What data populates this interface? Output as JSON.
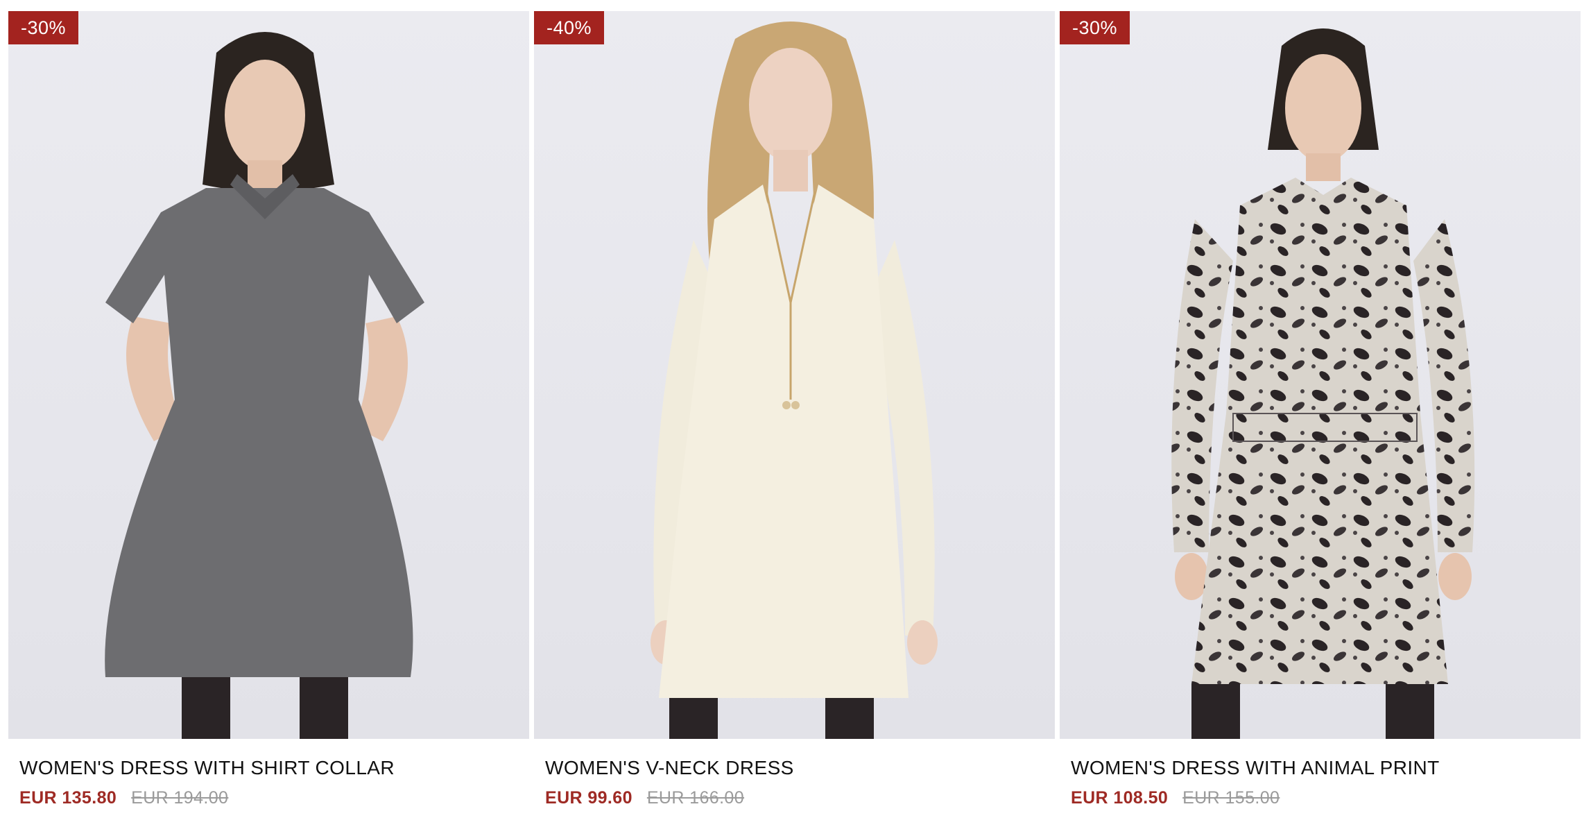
{
  "products": [
    {
      "badge": "-30%",
      "name": "WOMEN'S DRESS WITH SHIRT COLLAR",
      "sale_price": "EUR 135.80",
      "original_price": "EUR 194.00",
      "dress_color": "#6d6d70",
      "hair_color": "#2b2420"
    },
    {
      "badge": "-40%",
      "name": "WOMEN'S V-NECK DRESS",
      "sale_price": "EUR 99.60",
      "original_price": "EUR 166.00",
      "dress_color": "#f4efe0",
      "hair_color": "#c9a774"
    },
    {
      "badge": "-30%",
      "name": "WOMEN'S DRESS WITH ANIMAL PRINT",
      "sale_price": "EUR 108.50",
      "original_price": "EUR 155.00",
      "dress_color": "#d9d4cc",
      "hair_color": "#2b2420"
    }
  ]
}
